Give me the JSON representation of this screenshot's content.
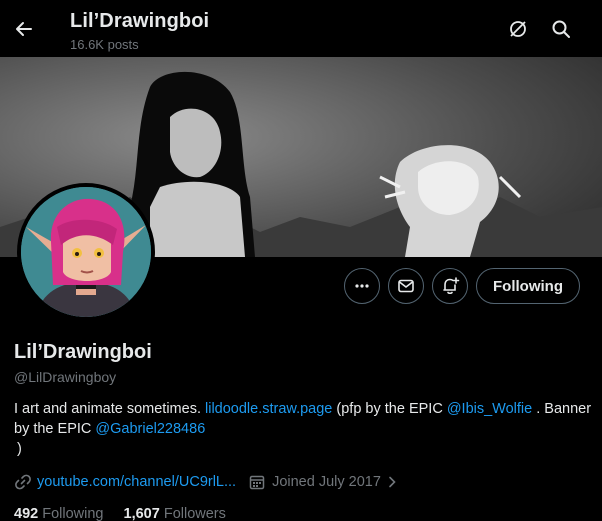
{
  "header": {
    "title": "Lil’Drawingboi",
    "posts": "16.6K posts"
  },
  "profile": {
    "name": "Lil’Drawingboi",
    "handle": "@LilDrawingboy",
    "following_button": "Following"
  },
  "bio": {
    "part1": "I art and animate sometimes. ",
    "link1": "lildoodle.straw.page",
    "part2": " (pfp by the EPIC ",
    "mention1": "@Ibis_Wolfie",
    "part3": " . Banner by the EPIC ",
    "mention2": "@Gabriel228486",
    "part4": ")"
  },
  "meta": {
    "website": "youtube.com/channel/UC9rlL...",
    "joined": "Joined July 2017"
  },
  "stats": {
    "following_count": "492",
    "following_label": "Following",
    "followers_count": "1,607",
    "followers_label": "Followers"
  },
  "colors": {
    "accent": "#1d9bf0",
    "secondary_text": "#71767b",
    "border": "#536471"
  }
}
